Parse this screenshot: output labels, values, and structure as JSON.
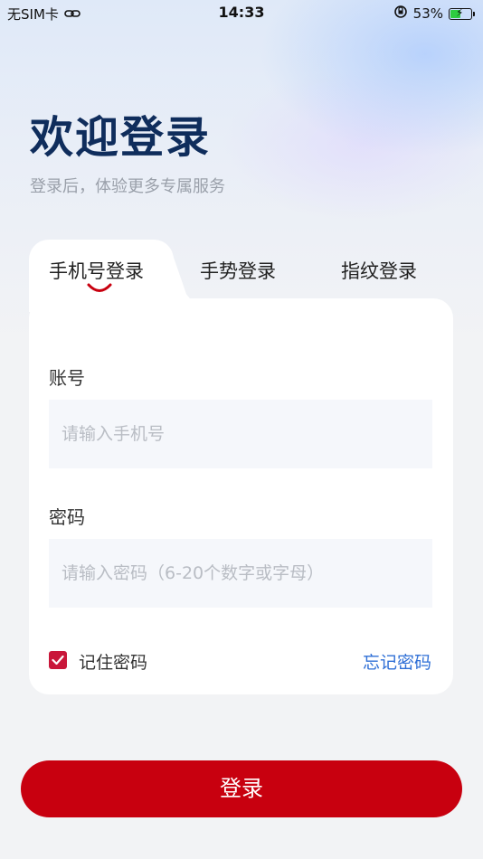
{
  "status_bar": {
    "carrier": "无SIM卡",
    "time": "14:33",
    "battery_percent": "53%",
    "battery_level": 0.53,
    "icons": [
      "link-icon",
      "orientation-lock-icon",
      "battery-charging-icon"
    ]
  },
  "header": {
    "title": "欢迎登录",
    "subtitle": "登录后，体验更多专属服务"
  },
  "tabs": [
    {
      "label": "手机号登录",
      "active": true
    },
    {
      "label": "手势登录",
      "active": false
    },
    {
      "label": "指纹登录",
      "active": false
    }
  ],
  "form": {
    "account_label": "账号",
    "account_placeholder": "请输入手机号",
    "password_label": "密码",
    "password_placeholder": "请输入密码（6-20个数字或字母）",
    "remember_label": "记住密码",
    "remember_checked": true,
    "forgot_label": "忘记密码"
  },
  "login_button": "登录",
  "colors": {
    "accent": "#c8000f",
    "title": "#0f2d5c",
    "link": "#2f6fd6"
  }
}
